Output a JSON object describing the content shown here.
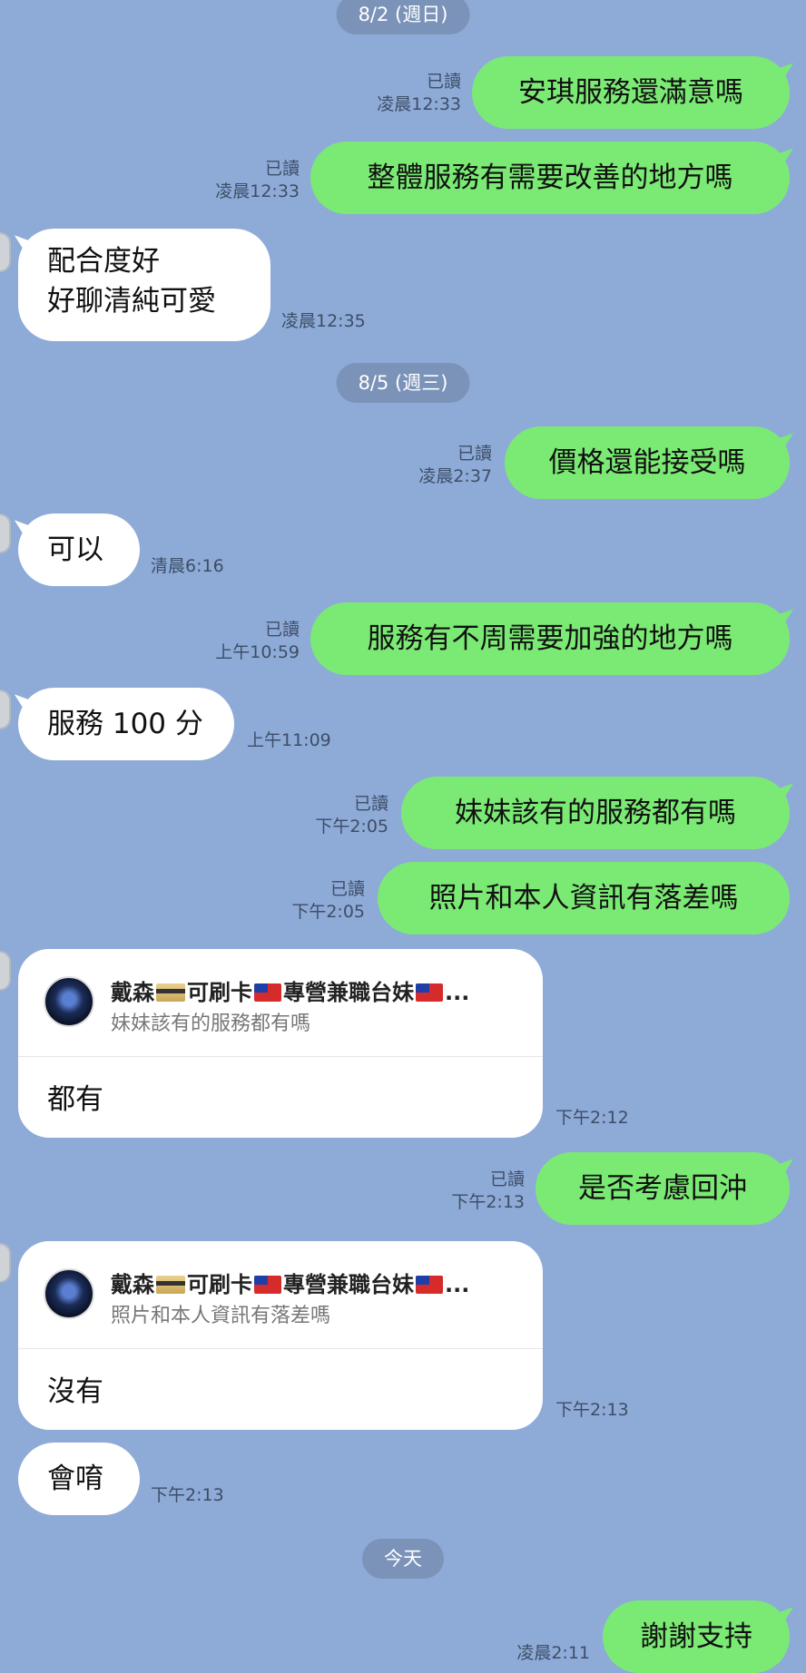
{
  "dates": {
    "d1": "8/2 (週日)",
    "d2": "8/5 (週三)",
    "d3": "今天"
  },
  "messages": {
    "m1": {
      "text": "安琪服務還滿意嗎",
      "read": "已讀",
      "time": "凌晨12:33"
    },
    "m2": {
      "text": "整體服務有需要改善的地方嗎",
      "read": "已讀",
      "time": "凌晨12:33"
    },
    "m3": {
      "line1": "配合度好",
      "line2": "好聊清純可愛",
      "time": "凌晨12:35"
    },
    "m4": {
      "text": "價格還能接受嗎",
      "read": "已讀",
      "time": "凌晨2:37"
    },
    "m5": {
      "text": "可以",
      "time": "清晨6:16"
    },
    "m6": {
      "text": "服務有不周需要加強的地方嗎",
      "read": "已讀",
      "time": "上午10:59"
    },
    "m7": {
      "text": "服務 100 分",
      "time": "上午11:09"
    },
    "m8": {
      "text": "妹妹該有的服務都有嗎",
      "read": "已讀",
      "time": "下午2:05"
    },
    "m9": {
      "text": "照片和本人資訊有落差嗎",
      "read": "已讀",
      "time": "下午2:05"
    },
    "m10": {
      "name_a": "戴森",
      "name_b": "可刷卡",
      "name_c": "專營兼職台妹",
      "name_d": "...",
      "quoted": "妹妹該有的服務都有嗎",
      "text": "都有",
      "time": "下午2:12"
    },
    "m11": {
      "text": "是否考慮回沖",
      "read": "已讀",
      "time": "下午2:13"
    },
    "m12": {
      "name_a": "戴森",
      "name_b": "可刷卡",
      "name_c": "專營兼職台妹",
      "name_d": "...",
      "quoted": "照片和本人資訊有落差嗎",
      "text": "沒有",
      "time": "下午2:13"
    },
    "m13": {
      "text": "會唷",
      "time": "下午2:13"
    },
    "m14": {
      "text": "謝謝支持",
      "time": "凌晨2:11"
    }
  },
  "colors": {
    "background": "#8eabd8",
    "sent_bubble": "#7bea74",
    "received_bubble": "#ffffff",
    "date_pill": "#7b93b8"
  },
  "icons": [
    "flag-icon",
    "credit-card-icon",
    "avatar"
  ]
}
